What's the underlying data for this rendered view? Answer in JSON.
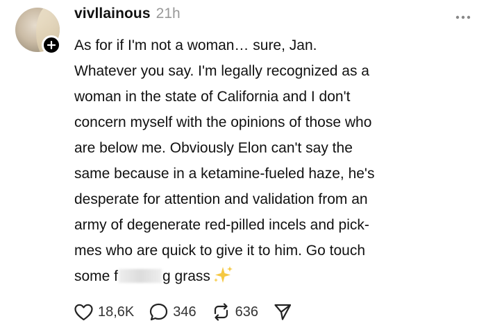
{
  "post": {
    "username": "vivllainous",
    "time": "21h",
    "lines": [
      "As for if I'm not a woman… sure, Jan.",
      "Whatever you say. I'm legally recognized as a",
      "woman in the state of California and I don't",
      "concern myself with the opinions of those who",
      "are below me. Obviously Elon can't say the",
      "same because in a ketamine-fueled haze, he's",
      "desperate for attention and validation from an",
      "army of degenerate red-pilled incels and pick-",
      "mes who are quick to give it to him. Go touch"
    ],
    "last_line_before": "some f",
    "last_line_after": "g grass"
  },
  "actions": {
    "likes": "18,6K",
    "replies": "346",
    "reposts": "636"
  },
  "icons": {
    "like": "heart-icon",
    "reply": "comment-icon",
    "repost": "repost-icon",
    "share": "send-icon",
    "more": "more-options-icon",
    "follow": "plus-icon",
    "sparkles": "sparkles-icon"
  },
  "colors": {
    "time": "#999999",
    "sparkle": "#f5c842"
  }
}
